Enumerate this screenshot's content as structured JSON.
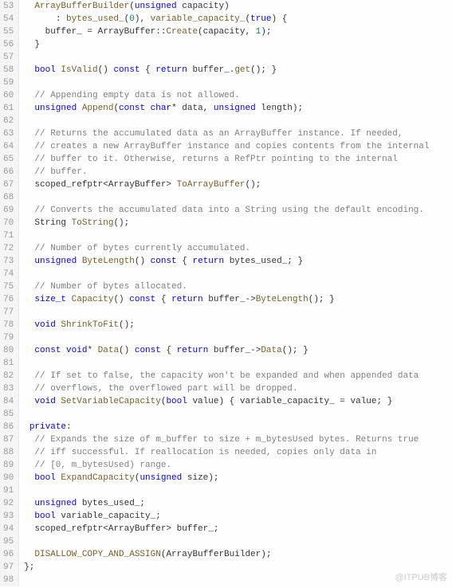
{
  "watermark": "@ITPUB博客",
  "startLine": 53,
  "lines": [
    {
      "i": "  ",
      "s": [
        {
          "c": "fn",
          "t": "ArrayBufferBuilder"
        },
        {
          "c": "",
          "t": "("
        },
        {
          "c": "kw",
          "t": "unsigned"
        },
        {
          "c": "",
          "t": " capacity)"
        }
      ]
    },
    {
      "i": "      ",
      "s": [
        {
          "c": "",
          "t": ": "
        },
        {
          "c": "fn",
          "t": "bytes_used_"
        },
        {
          "c": "",
          "t": "("
        },
        {
          "c": "num",
          "t": "0"
        },
        {
          "c": "",
          "t": "), "
        },
        {
          "c": "fn",
          "t": "variable_capacity_"
        },
        {
          "c": "",
          "t": "("
        },
        {
          "c": "kw",
          "t": "true"
        },
        {
          "c": "",
          "t": ") {"
        }
      ]
    },
    {
      "i": "    ",
      "s": [
        {
          "c": "",
          "t": "buffer_ = ArrayBuffer::"
        },
        {
          "c": "fn",
          "t": "Create"
        },
        {
          "c": "",
          "t": "(capacity, "
        },
        {
          "c": "num",
          "t": "1"
        },
        {
          "c": "",
          "t": ");"
        }
      ]
    },
    {
      "i": "  ",
      "s": [
        {
          "c": "",
          "t": "}"
        }
      ]
    },
    {
      "i": "",
      "s": []
    },
    {
      "i": "  ",
      "s": [
        {
          "c": "kw",
          "t": "bool"
        },
        {
          "c": "",
          "t": " "
        },
        {
          "c": "fn",
          "t": "IsValid"
        },
        {
          "c": "",
          "t": "() "
        },
        {
          "c": "kw",
          "t": "const"
        },
        {
          "c": "",
          "t": " { "
        },
        {
          "c": "kw",
          "t": "return"
        },
        {
          "c": "",
          "t": " buffer_."
        },
        {
          "c": "fn",
          "t": "get"
        },
        {
          "c": "",
          "t": "(); }"
        }
      ]
    },
    {
      "i": "",
      "s": []
    },
    {
      "i": "  ",
      "s": [
        {
          "c": "cmt",
          "t": "// Appending empty data is not allowed."
        }
      ]
    },
    {
      "i": "  ",
      "s": [
        {
          "c": "kw",
          "t": "unsigned"
        },
        {
          "c": "",
          "t": " "
        },
        {
          "c": "fn",
          "t": "Append"
        },
        {
          "c": "",
          "t": "("
        },
        {
          "c": "kw",
          "t": "const"
        },
        {
          "c": "",
          "t": " "
        },
        {
          "c": "kw",
          "t": "char"
        },
        {
          "c": "",
          "t": "* data, "
        },
        {
          "c": "kw",
          "t": "unsigned"
        },
        {
          "c": "",
          "t": " length);"
        }
      ]
    },
    {
      "i": "",
      "s": []
    },
    {
      "i": "  ",
      "s": [
        {
          "c": "cmt",
          "t": "// Returns the accumulated data as an ArrayBuffer instance. If needed,"
        }
      ]
    },
    {
      "i": "  ",
      "s": [
        {
          "c": "cmt",
          "t": "// creates a new ArrayBuffer instance and copies contents from the internal"
        }
      ]
    },
    {
      "i": "  ",
      "s": [
        {
          "c": "cmt",
          "t": "// buffer to it. Otherwise, returns a RefPtr pointing to the internal"
        }
      ]
    },
    {
      "i": "  ",
      "s": [
        {
          "c": "cmt",
          "t": "// buffer."
        }
      ]
    },
    {
      "i": "  ",
      "s": [
        {
          "c": "",
          "t": "scoped_refptr<ArrayBuffer> "
        },
        {
          "c": "fn",
          "t": "ToArrayBuffer"
        },
        {
          "c": "",
          "t": "();"
        }
      ]
    },
    {
      "i": "",
      "s": []
    },
    {
      "i": "  ",
      "s": [
        {
          "c": "cmt",
          "t": "// Converts the accumulated data into a String using the default encoding."
        }
      ]
    },
    {
      "i": "  ",
      "s": [
        {
          "c": "",
          "t": "String "
        },
        {
          "c": "fn",
          "t": "ToString"
        },
        {
          "c": "",
          "t": "();"
        }
      ]
    },
    {
      "i": "",
      "s": []
    },
    {
      "i": "  ",
      "s": [
        {
          "c": "cmt",
          "t": "// Number of bytes currently accumulated."
        }
      ]
    },
    {
      "i": "  ",
      "s": [
        {
          "c": "kw",
          "t": "unsigned"
        },
        {
          "c": "",
          "t": " "
        },
        {
          "c": "fn",
          "t": "ByteLength"
        },
        {
          "c": "",
          "t": "() "
        },
        {
          "c": "kw",
          "t": "const"
        },
        {
          "c": "",
          "t": " { "
        },
        {
          "c": "kw",
          "t": "return"
        },
        {
          "c": "",
          "t": " bytes_used_; }"
        }
      ]
    },
    {
      "i": "",
      "s": []
    },
    {
      "i": "  ",
      "s": [
        {
          "c": "cmt",
          "t": "// Number of bytes allocated."
        }
      ]
    },
    {
      "i": "  ",
      "s": [
        {
          "c": "kw",
          "t": "size_t"
        },
        {
          "c": "",
          "t": " "
        },
        {
          "c": "fn",
          "t": "Capacity"
        },
        {
          "c": "",
          "t": "() "
        },
        {
          "c": "kw",
          "t": "const"
        },
        {
          "c": "",
          "t": " { "
        },
        {
          "c": "kw",
          "t": "return"
        },
        {
          "c": "",
          "t": " buffer_->"
        },
        {
          "c": "fn",
          "t": "ByteLength"
        },
        {
          "c": "",
          "t": "(); }"
        }
      ]
    },
    {
      "i": "",
      "s": []
    },
    {
      "i": "  ",
      "s": [
        {
          "c": "kw",
          "t": "void"
        },
        {
          "c": "",
          "t": " "
        },
        {
          "c": "fn",
          "t": "ShrinkToFit"
        },
        {
          "c": "",
          "t": "();"
        }
      ]
    },
    {
      "i": "",
      "s": []
    },
    {
      "i": "  ",
      "s": [
        {
          "c": "kw",
          "t": "const"
        },
        {
          "c": "",
          "t": " "
        },
        {
          "c": "kw",
          "t": "void"
        },
        {
          "c": "",
          "t": "* "
        },
        {
          "c": "fn",
          "t": "Data"
        },
        {
          "c": "",
          "t": "() "
        },
        {
          "c": "kw",
          "t": "const"
        },
        {
          "c": "",
          "t": " { "
        },
        {
          "c": "kw",
          "t": "return"
        },
        {
          "c": "",
          "t": " buffer_->"
        },
        {
          "c": "fn",
          "t": "Data"
        },
        {
          "c": "",
          "t": "(); }"
        }
      ]
    },
    {
      "i": "",
      "s": []
    },
    {
      "i": "  ",
      "s": [
        {
          "c": "cmt",
          "t": "// If set to false, the capacity won't be expanded and when appended data"
        }
      ]
    },
    {
      "i": "  ",
      "s": [
        {
          "c": "cmt",
          "t": "// overflows, the overflowed part will be dropped."
        }
      ]
    },
    {
      "i": "  ",
      "s": [
        {
          "c": "kw",
          "t": "void"
        },
        {
          "c": "",
          "t": " "
        },
        {
          "c": "fn",
          "t": "SetVariableCapacity"
        },
        {
          "c": "",
          "t": "("
        },
        {
          "c": "kw",
          "t": "bool"
        },
        {
          "c": "",
          "t": " value) { variable_capacity_ = value; }"
        }
      ]
    },
    {
      "i": "",
      "s": []
    },
    {
      "i": " ",
      "s": [
        {
          "c": "kw",
          "t": "private"
        },
        {
          "c": "",
          "t": ":"
        }
      ]
    },
    {
      "i": "  ",
      "s": [
        {
          "c": "cmt",
          "t": "// Expands the size of m_buffer to size + m_bytesUsed bytes. Returns true"
        }
      ]
    },
    {
      "i": "  ",
      "s": [
        {
          "c": "cmt",
          "t": "// iff successful. If reallocation is needed, copies only data in"
        }
      ]
    },
    {
      "i": "  ",
      "s": [
        {
          "c": "cmt",
          "t": "// [0, m_bytesUsed) range."
        }
      ]
    },
    {
      "i": "  ",
      "s": [
        {
          "c": "kw",
          "t": "bool"
        },
        {
          "c": "",
          "t": " "
        },
        {
          "c": "fn",
          "t": "ExpandCapacity"
        },
        {
          "c": "",
          "t": "("
        },
        {
          "c": "kw",
          "t": "unsigned"
        },
        {
          "c": "",
          "t": " size);"
        }
      ]
    },
    {
      "i": "",
      "s": []
    },
    {
      "i": "  ",
      "s": [
        {
          "c": "kw",
          "t": "unsigned"
        },
        {
          "c": "",
          "t": " bytes_used_;"
        }
      ]
    },
    {
      "i": "  ",
      "s": [
        {
          "c": "kw",
          "t": "bool"
        },
        {
          "c": "",
          "t": " variable_capacity_;"
        }
      ]
    },
    {
      "i": "  ",
      "s": [
        {
          "c": "",
          "t": "scoped_refptr<ArrayBuffer> buffer_;"
        }
      ]
    },
    {
      "i": "",
      "s": []
    },
    {
      "i": "  ",
      "s": [
        {
          "c": "fn",
          "t": "DISALLOW_COPY_AND_ASSIGN"
        },
        {
          "c": "",
          "t": "(ArrayBufferBuilder);"
        }
      ]
    },
    {
      "i": "",
      "s": [
        {
          "c": "",
          "t": "};"
        }
      ]
    },
    {
      "i": "",
      "s": []
    }
  ]
}
